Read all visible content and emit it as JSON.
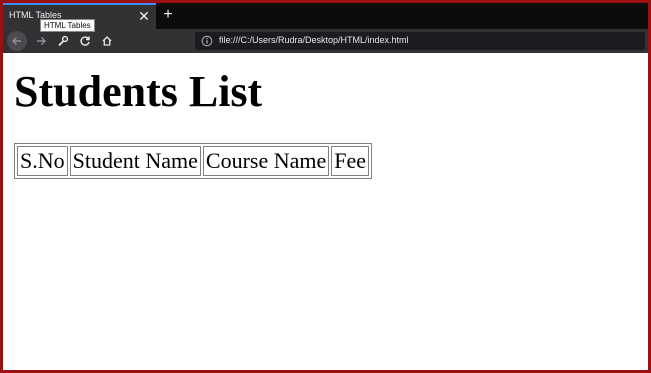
{
  "browser": {
    "tab_title": "HTML Tables",
    "tooltip": "HTML Tables",
    "new_tab_symbol": "+",
    "close_symbol": "✕",
    "url": "file:///C:/Users/Rudra/Desktop/HTML/index.html",
    "icons": [
      "back-arrow-icon",
      "forward-arrow-icon",
      "wrench-icon",
      "reload-icon",
      "home-icon",
      "info-icon"
    ]
  },
  "page": {
    "heading": "Students List",
    "table": {
      "cells": [
        "S.No",
        "Student Name",
        "Course Name",
        "Fee"
      ]
    }
  },
  "colors": {
    "frame_border": "#9b1010",
    "tab_bar": "#0c0c0d",
    "toolbar": "#323234",
    "url_bar": "#1c1b22"
  }
}
